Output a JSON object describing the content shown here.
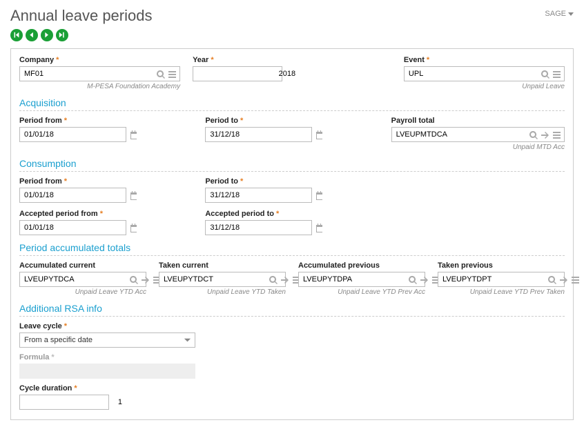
{
  "header": {
    "title": "Annual leave periods",
    "brand": "SAGE"
  },
  "topRow": {
    "company": {
      "label": "Company",
      "value": "MF01",
      "hint": "M-PESA Foundation Academy"
    },
    "year": {
      "label": "Year",
      "value": "2018"
    },
    "event": {
      "label": "Event",
      "value": "UPL",
      "hint": "Unpaid Leave"
    }
  },
  "acquisition": {
    "title": "Acquisition",
    "periodFrom": {
      "label": "Period from",
      "value": "01/01/18"
    },
    "periodTo": {
      "label": "Period to",
      "value": "31/12/18"
    },
    "payrollTotal": {
      "label": "Payroll total",
      "value": "LVEUPMTDCA",
      "hint": "Unpaid MTD Acc"
    }
  },
  "consumption": {
    "title": "Consumption",
    "periodFrom": {
      "label": "Period from",
      "value": "01/01/18"
    },
    "periodTo": {
      "label": "Period to",
      "value": "31/12/18"
    },
    "acceptedFrom": {
      "label": "Accepted period from",
      "value": "01/01/18"
    },
    "acceptedTo": {
      "label": "Accepted period to",
      "value": "31/12/18"
    }
  },
  "totals": {
    "title": "Period accumulated totals",
    "accCurrent": {
      "label": "Accumulated current",
      "value": "LVEUPYTDCA",
      "hint": "Unpaid Leave YTD Acc"
    },
    "takenCurrent": {
      "label": "Taken current",
      "value": "LVEUPYTDCT",
      "hint": "Unpaid Leave YTD Taken"
    },
    "accPrev": {
      "label": "Accumulated previous",
      "value": "LVEUPYTDPA",
      "hint": "Unpaid Leave YTD Prev Acc"
    },
    "takenPrev": {
      "label": "Taken previous",
      "value": "LVEUPYTDPT",
      "hint": "Unpaid Leave YTD Prev Taken"
    }
  },
  "rsa": {
    "title": "Additional RSA info",
    "leaveCycle": {
      "label": "Leave cycle",
      "value": "From a specific date"
    },
    "formula": {
      "label": "Formula"
    },
    "cycleDuration": {
      "label": "Cycle duration",
      "value": "1"
    }
  }
}
